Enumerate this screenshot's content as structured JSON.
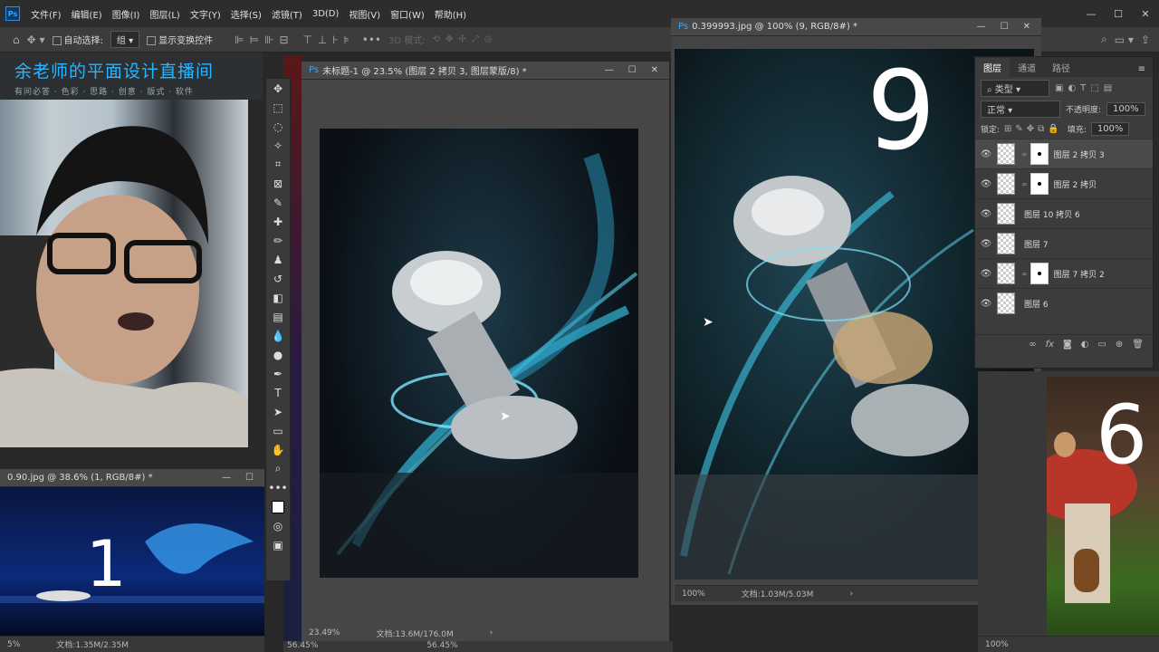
{
  "app": {
    "logo": "Ps"
  },
  "menu": [
    "文件(F)",
    "编辑(E)",
    "图像(I)",
    "图层(L)",
    "文字(Y)",
    "选择(S)",
    "滤镜(T)",
    "3D(D)",
    "视图(V)",
    "窗口(W)",
    "帮助(H)"
  ],
  "options": {
    "auto_select_label": "自动选择:",
    "auto_select_value": "组",
    "show_transform_label": "显示变换控件",
    "mode_3d_label": "3D 模式:"
  },
  "brand": {
    "title": "余老师的平面设计直播间",
    "subtitle": "有问必答 · 色彩 · 思路 · 创意 · 版式 · 软件"
  },
  "doc_main": {
    "title": "未标题-1 @ 23.5% (图层 2 拷贝 3, 图层蒙版/8) *",
    "zoom": "23.49%",
    "doc_size": "文档:13.6M/176.0M"
  },
  "doc_right": {
    "title": "0.399993.jpg @ 100% (9, RGB/8#) *",
    "zoom": "100%",
    "doc_size": "文档:1.03M/5.03M",
    "big_number": "9"
  },
  "doc_left": {
    "title": "0.90.jpg @ 38.6% (1, RGB/8#) *",
    "zoom": "5%",
    "doc_size": "文档:1.35M/2.35M",
    "big_number": "1"
  },
  "doc_far": {
    "big_number": "6",
    "zoom": "100%"
  },
  "bottom_zooms": [
    "56.45%",
    "56.45%"
  ],
  "layers": {
    "tabs": [
      "图层",
      "通道",
      "路径"
    ],
    "filter_kind": "类型",
    "blend_mode": "正常",
    "opacity_label": "不透明度:",
    "opacity": "100%",
    "lock_label": "锁定:",
    "fill_label": "填充:",
    "fill": "100%",
    "items": [
      {
        "name": "图层 2 拷贝 3",
        "mask": true
      },
      {
        "name": "图层 2 拷贝",
        "mask": true
      },
      {
        "name": "图层 10 拷贝 6",
        "mask": false
      },
      {
        "name": "图层 7",
        "mask": false
      },
      {
        "name": "图层 7 拷贝 2",
        "mask": true
      },
      {
        "name": "图层 6",
        "mask": false
      }
    ],
    "fx_label": "fx"
  }
}
